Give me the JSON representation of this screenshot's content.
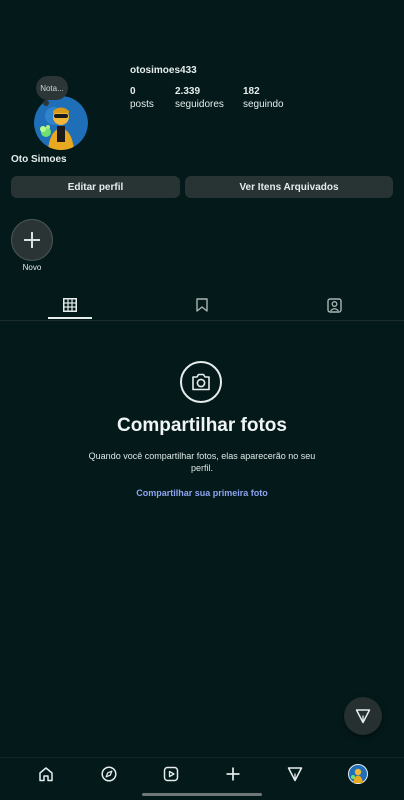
{
  "profile": {
    "username": "otosimoes433",
    "display_name": "Oto Simoes",
    "note": "Nota...",
    "stats": [
      {
        "value": "0",
        "label": "posts"
      },
      {
        "value": "2.339",
        "label": "seguidores"
      },
      {
        "value": "182",
        "label": "seguindo"
      }
    ]
  },
  "actions": {
    "edit_profile": "Editar perfil",
    "archived": "Ver Itens Arquivados"
  },
  "stories": {
    "new_label": "Novo"
  },
  "tabs": [
    {
      "icon": "grid-icon",
      "selected": true
    },
    {
      "icon": "bookmark-icon",
      "selected": false
    },
    {
      "icon": "tagged-person-icon",
      "selected": false
    }
  ],
  "empty_state": {
    "icon": "camera-icon",
    "title": "Compartilhar fotos",
    "description": "Quando você compartilhar fotos, elas aparecerão no seu perfil.",
    "link": "Compartilhar sua primeira foto"
  },
  "bottom_nav": [
    "home-icon",
    "explore-icon",
    "reels-icon",
    "create-icon",
    "direct-icon",
    "profile-avatar-icon"
  ],
  "colors": {
    "background": "#041a1a",
    "button": "#283434",
    "link": "#8ea4f2"
  }
}
